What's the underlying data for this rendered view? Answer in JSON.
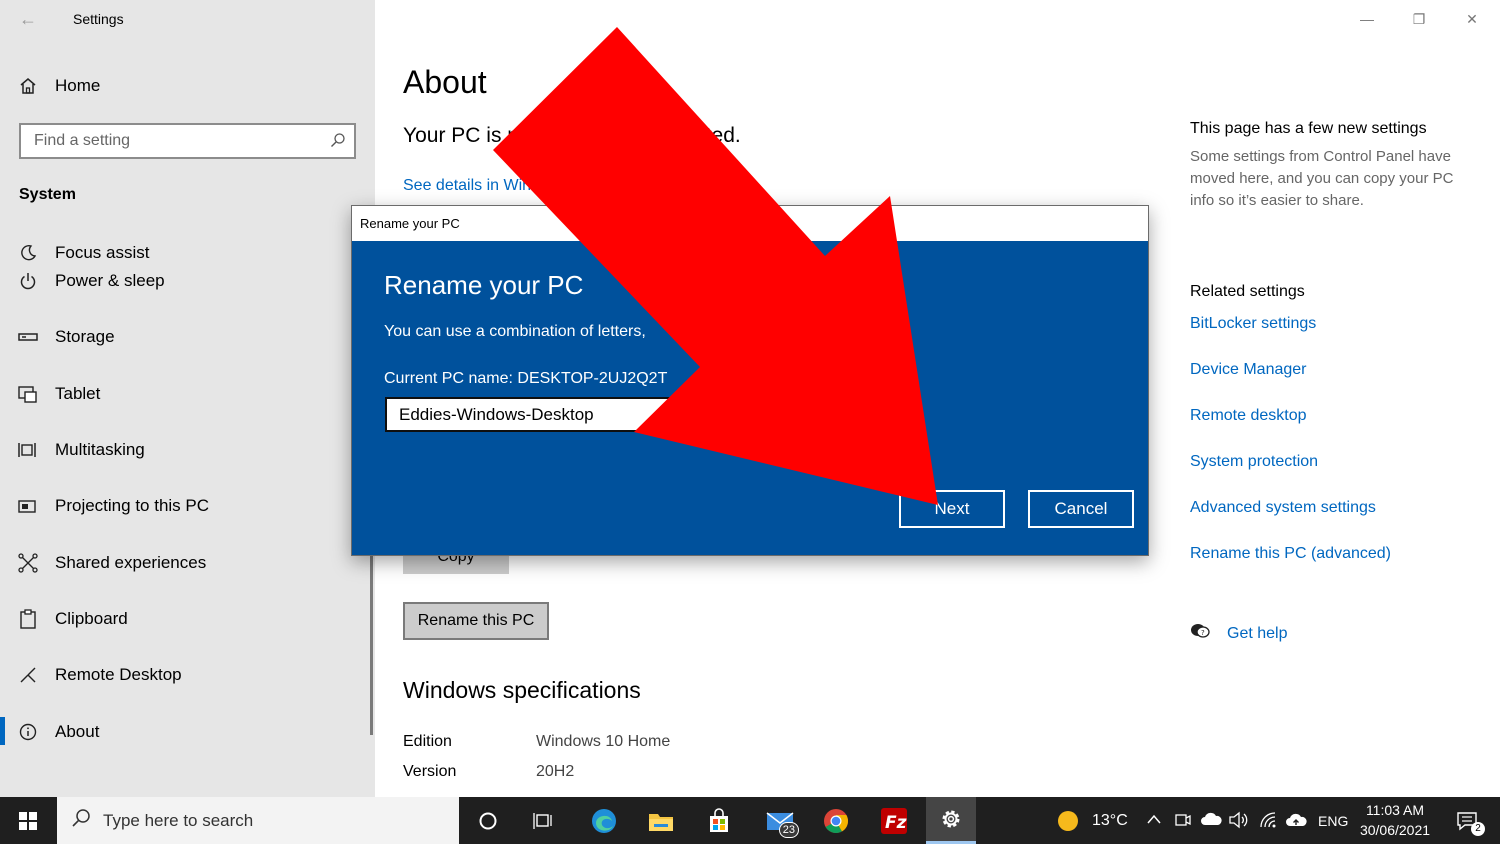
{
  "window": {
    "app_title": "Settings",
    "back_glyph": "←",
    "minimize_glyph": "—",
    "maximize_glyph": "❐",
    "close_glyph": "✕"
  },
  "sidebar": {
    "home_label": "Home",
    "search_placeholder": "Find a setting",
    "section_title": "System",
    "items": [
      {
        "label": "Focus assist",
        "icon": "moon-icon"
      },
      {
        "label": "Power & sleep",
        "icon": "power-icon"
      },
      {
        "label": "Storage",
        "icon": "storage-icon"
      },
      {
        "label": "Tablet",
        "icon": "tablet-icon"
      },
      {
        "label": "Multitasking",
        "icon": "multitasking-icon"
      },
      {
        "label": "Projecting to this PC",
        "icon": "projecting-icon"
      },
      {
        "label": "Shared experiences",
        "icon": "shared-icon"
      },
      {
        "label": "Clipboard",
        "icon": "clipboard-icon"
      },
      {
        "label": "Remote Desktop",
        "icon": "remote-desktop-icon"
      },
      {
        "label": "About",
        "icon": "info-icon",
        "active": true
      }
    ]
  },
  "main": {
    "title": "About",
    "protected_text": "Your PC is monitored and protected.",
    "details_link": "See details in Windows Security",
    "copy_button": "Copy",
    "rename_button": "Rename this PC",
    "spec_title": "Windows specifications",
    "specs": [
      {
        "key": "Edition",
        "value": "Windows 10 Home"
      },
      {
        "key": "Version",
        "value": "20H2"
      }
    ]
  },
  "right": {
    "new_settings_heading": "This page has a few new settings",
    "new_settings_desc": "Some settings from Control Panel have moved here, and you can copy your PC info so it’s easier to share.",
    "related_heading": "Related settings",
    "related_links": [
      "BitLocker settings",
      "Device Manager",
      "Remote desktop",
      "System protection",
      "Advanced system settings",
      "Rename this PC (advanced)"
    ],
    "get_help": "Get help"
  },
  "dialog": {
    "window_title": "Rename your PC",
    "heading": "Rename your PC",
    "description": "You can use a combination of letters,",
    "current_name": "Current PC name: DESKTOP-2UJ2Q2T",
    "input_value": "Eddies-Windows-Desktop",
    "next_button": "Next",
    "cancel_button": "Cancel"
  },
  "annotation": {
    "arrow_color": "#ff0000"
  },
  "taskbar": {
    "search_placeholder": "Type here to search",
    "mail_badge": "23",
    "weather": "13°C",
    "language": "ENG",
    "time": "11:03 AM",
    "date": "30/06/2021",
    "notification_count": "2"
  },
  "colors": {
    "accent": "#0067c0",
    "dialog_bg": "#00519c",
    "sidebar_bg": "#e6e6e6",
    "taskbar_bg": "#1f1f1f"
  }
}
